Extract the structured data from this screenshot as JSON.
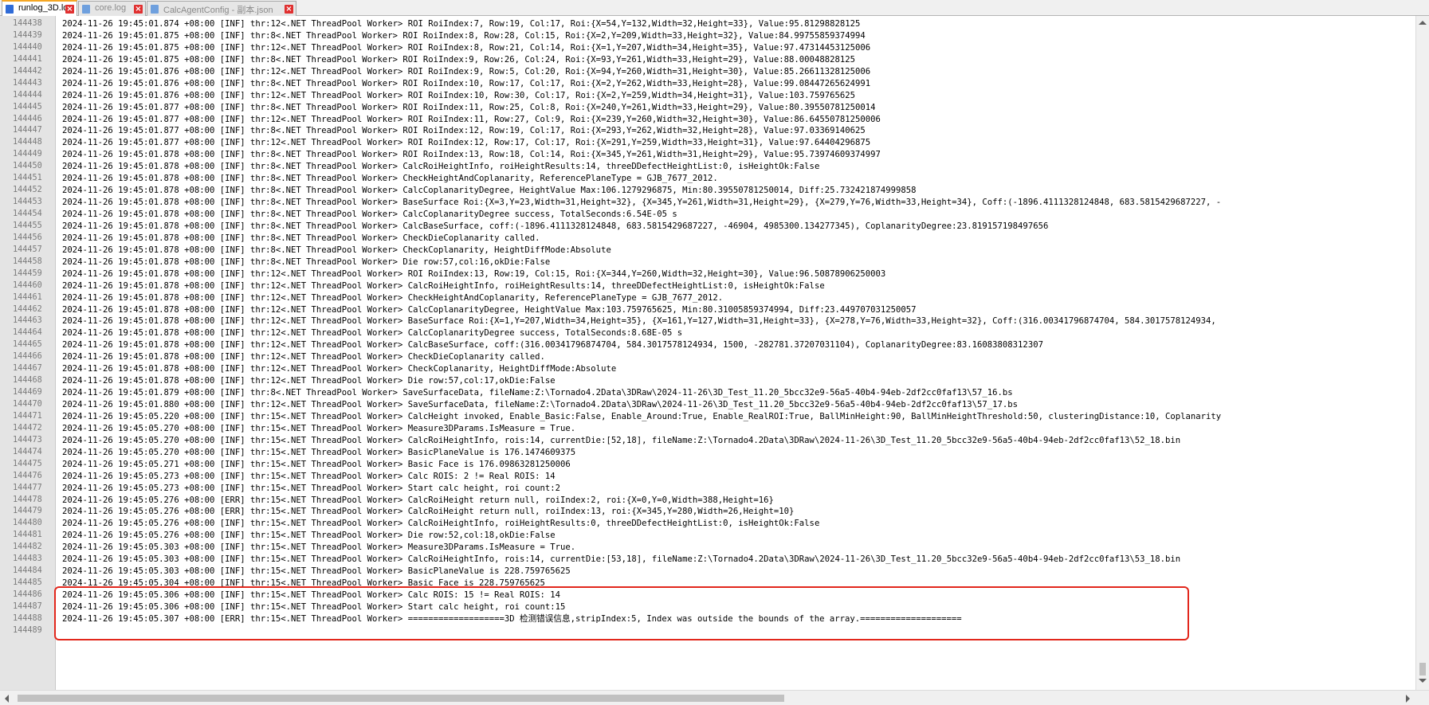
{
  "tabs": [
    {
      "label": "runlog_3D.log",
      "active": true
    },
    {
      "label": "core.log",
      "active": false
    },
    {
      "label": "CalcAgentConfig - 副本.json",
      "active": false
    }
  ],
  "log": {
    "lines": [
      {
        "num": "144438",
        "text": "2024-11-26 19:45:01.874 +08:00 [INF] thr:12<.NET ThreadPool Worker> ROI RoiIndex:7, Row:19, Col:17, Roi:{X=54,Y=132,Width=32,Height=33}, Value:95.81298828125"
      },
      {
        "num": "144439",
        "text": "2024-11-26 19:45:01.875 +08:00 [INF] thr:8<.NET ThreadPool Worker> ROI RoiIndex:8, Row:28, Col:15, Roi:{X=2,Y=209,Width=33,Height=32}, Value:84.99755859374994"
      },
      {
        "num": "144440",
        "text": "2024-11-26 19:45:01.875 +08:00 [INF] thr:12<.NET ThreadPool Worker> ROI RoiIndex:8, Row:21, Col:14, Roi:{X=1,Y=207,Width=34,Height=35}, Value:97.47314453125006"
      },
      {
        "num": "144441",
        "text": "2024-11-26 19:45:01.875 +08:00 [INF] thr:8<.NET ThreadPool Worker> ROI RoiIndex:9, Row:26, Col:24, Roi:{X=93,Y=261,Width=33,Height=29}, Value:88.00048828125"
      },
      {
        "num": "144442",
        "text": "2024-11-26 19:45:01.876 +08:00 [INF] thr:12<.NET ThreadPool Worker> ROI RoiIndex:9, Row:5, Col:20, Roi:{X=94,Y=260,Width=31,Height=30}, Value:85.26611328125006"
      },
      {
        "num": "144443",
        "text": "2024-11-26 19:45:01.876 +08:00 [INF] thr:8<.NET ThreadPool Worker> ROI RoiIndex:10, Row:17, Col:17, Roi:{X=2,Y=262,Width=33,Height=28}, Value:99.08447265624991"
      },
      {
        "num": "144444",
        "text": "2024-11-26 19:45:01.876 +08:00 [INF] thr:12<.NET ThreadPool Worker> ROI RoiIndex:10, Row:30, Col:17, Roi:{X=2,Y=259,Width=34,Height=31}, Value:103.759765625"
      },
      {
        "num": "144445",
        "text": "2024-11-26 19:45:01.877 +08:00 [INF] thr:8<.NET ThreadPool Worker> ROI RoiIndex:11, Row:25, Col:8, Roi:{X=240,Y=261,Width=33,Height=29}, Value:80.39550781250014"
      },
      {
        "num": "144446",
        "text": "2024-11-26 19:45:01.877 +08:00 [INF] thr:12<.NET ThreadPool Worker> ROI RoiIndex:11, Row:27, Col:9, Roi:{X=239,Y=260,Width=32,Height=30}, Value:86.64550781250006"
      },
      {
        "num": "144447",
        "text": "2024-11-26 19:45:01.877 +08:00 [INF] thr:8<.NET ThreadPool Worker> ROI RoiIndex:12, Row:19, Col:17, Roi:{X=293,Y=262,Width=32,Height=28}, Value:97.03369140625"
      },
      {
        "num": "144448",
        "text": "2024-11-26 19:45:01.877 +08:00 [INF] thr:12<.NET ThreadPool Worker> ROI RoiIndex:12, Row:17, Col:17, Roi:{X=291,Y=259,Width=33,Height=31}, Value:97.64404296875"
      },
      {
        "num": "144449",
        "text": "2024-11-26 19:45:01.878 +08:00 [INF] thr:8<.NET ThreadPool Worker> ROI RoiIndex:13, Row:18, Col:14, Roi:{X=345,Y=261,Width=31,Height=29}, Value:95.73974609374997"
      },
      {
        "num": "144450",
        "text": "2024-11-26 19:45:01.878 +08:00 [INF] thr:8<.NET ThreadPool Worker> CalcRoiHeightInfo, roiHeightResults:14, threeDDefectHeightList:0, isHeightOk:False"
      },
      {
        "num": "144451",
        "text": "2024-11-26 19:45:01.878 +08:00 [INF] thr:8<.NET ThreadPool Worker> CheckHeightAndCoplanarity, ReferencePlaneType = GJB_7677_2012."
      },
      {
        "num": "144452",
        "text": "2024-11-26 19:45:01.878 +08:00 [INF] thr:8<.NET ThreadPool Worker> CalcCoplanarityDegree, HeightValue Max:106.1279296875, Min:80.39550781250014, Diff:25.732421874999858"
      },
      {
        "num": "144453",
        "text": "2024-11-26 19:45:01.878 +08:00 [INF] thr:8<.NET ThreadPool Worker> BaseSurface Roi:{X=3,Y=23,Width=31,Height=32}, {X=345,Y=261,Width=31,Height=29}, {X=279,Y=76,Width=33,Height=34}, Coff:(-1896.4111328124848, 683.5815429687227, -"
      },
      {
        "num": "144454",
        "text": "2024-11-26 19:45:01.878 +08:00 [INF] thr:8<.NET ThreadPool Worker> CalcCoplanarityDegree success, TotalSeconds:6.54E-05 s"
      },
      {
        "num": "144455",
        "text": "2024-11-26 19:45:01.878 +08:00 [INF] thr:8<.NET ThreadPool Worker> CalcBaseSurface, coff:(-1896.4111328124848, 683.5815429687227, -46904, 4985300.134277345), CoplanarityDegree:23.819157198497656"
      },
      {
        "num": "144456",
        "text": "2024-11-26 19:45:01.878 +08:00 [INF] thr:8<.NET ThreadPool Worker> CheckDieCoplanarity called."
      },
      {
        "num": "144457",
        "text": "2024-11-26 19:45:01.878 +08:00 [INF] thr:8<.NET ThreadPool Worker> CheckCoplanarity, HeightDiffMode:Absolute"
      },
      {
        "num": "144458",
        "text": "2024-11-26 19:45:01.878 +08:00 [INF] thr:8<.NET ThreadPool Worker> Die row:57,col:16,okDie:False"
      },
      {
        "num": "144459",
        "text": "2024-11-26 19:45:01.878 +08:00 [INF] thr:12<.NET ThreadPool Worker> ROI RoiIndex:13, Row:19, Col:15, Roi:{X=344,Y=260,Width=32,Height=30}, Value:96.50878906250003"
      },
      {
        "num": "144460",
        "text": "2024-11-26 19:45:01.878 +08:00 [INF] thr:12<.NET ThreadPool Worker> CalcRoiHeightInfo, roiHeightResults:14, threeDDefectHeightList:0, isHeightOk:False"
      },
      {
        "num": "144461",
        "text": "2024-11-26 19:45:01.878 +08:00 [INF] thr:12<.NET ThreadPool Worker> CheckHeightAndCoplanarity, ReferencePlaneType = GJB_7677_2012."
      },
      {
        "num": "144462",
        "text": "2024-11-26 19:45:01.878 +08:00 [INF] thr:12<.NET ThreadPool Worker> CalcCoplanarityDegree, HeightValue Max:103.759765625, Min:80.31005859374994, Diff:23.449707031250057"
      },
      {
        "num": "144463",
        "text": "2024-11-26 19:45:01.878 +08:00 [INF] thr:12<.NET ThreadPool Worker> BaseSurface Roi:{X=1,Y=207,Width=34,Height=35}, {X=161,Y=127,Width=31,Height=33}, {X=278,Y=76,Width=33,Height=32}, Coff:(316.00341796874704, 584.3017578124934,"
      },
      {
        "num": "144464",
        "text": "2024-11-26 19:45:01.878 +08:00 [INF] thr:12<.NET ThreadPool Worker> CalcCoplanarityDegree success, TotalSeconds:8.68E-05 s"
      },
      {
        "num": "144465",
        "text": "2024-11-26 19:45:01.878 +08:00 [INF] thr:12<.NET ThreadPool Worker> CalcBaseSurface, coff:(316.00341796874704, 584.3017578124934, 1500, -282781.37207031104), CoplanarityDegree:83.16083808312307"
      },
      {
        "num": "144466",
        "text": "2024-11-26 19:45:01.878 +08:00 [INF] thr:12<.NET ThreadPool Worker> CheckDieCoplanarity called."
      },
      {
        "num": "144467",
        "text": "2024-11-26 19:45:01.878 +08:00 [INF] thr:12<.NET ThreadPool Worker> CheckCoplanarity, HeightDiffMode:Absolute"
      },
      {
        "num": "144468",
        "text": "2024-11-26 19:45:01.878 +08:00 [INF] thr:12<.NET ThreadPool Worker> Die row:57,col:17,okDie:False"
      },
      {
        "num": "144469",
        "text": "2024-11-26 19:45:01.879 +08:00 [INF] thr:8<.NET ThreadPool Worker> SaveSurfaceData, fileName:Z:\\Tornado4.2Data\\3DRaw\\2024-11-26\\3D_Test_11.20_5bcc32e9-56a5-40b4-94eb-2df2cc0faf13\\57_16.bs"
      },
      {
        "num": "144470",
        "text": "2024-11-26 19:45:01.880 +08:00 [INF] thr:12<.NET ThreadPool Worker> SaveSurfaceData, fileName:Z:\\Tornado4.2Data\\3DRaw\\2024-11-26\\3D_Test_11.20_5bcc32e9-56a5-40b4-94eb-2df2cc0faf13\\57_17.bs"
      },
      {
        "num": "144471",
        "text": "2024-11-26 19:45:05.220 +08:00 [INF] thr:15<.NET ThreadPool Worker> CalcHeight invoked, Enable_Basic:False, Enable_Around:True, Enable_RealROI:True, BallMinHeight:90, BallMinHeightThreshold:50, clusteringDistance:10, Coplanarity"
      },
      {
        "num": "144472",
        "text": "2024-11-26 19:45:05.270 +08:00 [INF] thr:15<.NET ThreadPool Worker> Measure3DParams.IsMeasure = True."
      },
      {
        "num": "144473",
        "text": "2024-11-26 19:45:05.270 +08:00 [INF] thr:15<.NET ThreadPool Worker> CalcRoiHeightInfo, rois:14, currentDie:[52,18], fileName:Z:\\Tornado4.2Data\\3DRaw\\2024-11-26\\3D_Test_11.20_5bcc32e9-56a5-40b4-94eb-2df2cc0faf13\\52_18.bin"
      },
      {
        "num": "144474",
        "text": "2024-11-26 19:45:05.270 +08:00 [INF] thr:15<.NET ThreadPool Worker> BasicPlaneValue is 176.1474609375"
      },
      {
        "num": "144475",
        "text": "2024-11-26 19:45:05.271 +08:00 [INF] thr:15<.NET ThreadPool Worker> Basic Face is 176.09863281250006"
      },
      {
        "num": "144476",
        "text": "2024-11-26 19:45:05.273 +08:00 [INF] thr:15<.NET ThreadPool Worker> Calc ROIS: 2 != Real ROIS: 14"
      },
      {
        "num": "144477",
        "text": "2024-11-26 19:45:05.273 +08:00 [INF] thr:15<.NET ThreadPool Worker> Start calc height, roi count:2"
      },
      {
        "num": "144478",
        "text": "2024-11-26 19:45:05.276 +08:00 [ERR] thr:15<.NET ThreadPool Worker> CalcRoiHeight return null, roiIndex:2, roi:{X=0,Y=0,Width=388,Height=16}"
      },
      {
        "num": "144479",
        "text": "2024-11-26 19:45:05.276 +08:00 [ERR] thr:15<.NET ThreadPool Worker> CalcRoiHeight return null, roiIndex:13, roi:{X=345,Y=280,Width=26,Height=10}"
      },
      {
        "num": "144480",
        "text": "2024-11-26 19:45:05.276 +08:00 [INF] thr:15<.NET ThreadPool Worker> CalcRoiHeightInfo, roiHeightResults:0, threeDDefectHeightList:0, isHeightOk:False"
      },
      {
        "num": "144481",
        "text": "2024-11-26 19:45:05.276 +08:00 [INF] thr:15<.NET ThreadPool Worker> Die row:52,col:18,okDie:False"
      },
      {
        "num": "144482",
        "text": "2024-11-26 19:45:05.303 +08:00 [INF] thr:15<.NET ThreadPool Worker> Measure3DParams.IsMeasure = True."
      },
      {
        "num": "144483",
        "text": "2024-11-26 19:45:05.303 +08:00 [INF] thr:15<.NET ThreadPool Worker> CalcRoiHeightInfo, rois:14, currentDie:[53,18], fileName:Z:\\Tornado4.2Data\\3DRaw\\2024-11-26\\3D_Test_11.20_5bcc32e9-56a5-40b4-94eb-2df2cc0faf13\\53_18.bin"
      },
      {
        "num": "144484",
        "text": "2024-11-26 19:45:05.303 +08:00 [INF] thr:15<.NET ThreadPool Worker> BasicPlaneValue is 228.759765625"
      },
      {
        "num": "144485",
        "text": "2024-11-26 19:45:05.304 +08:00 [INF] thr:15<.NET ThreadPool Worker> Basic Face is 228.759765625"
      },
      {
        "num": "144486",
        "text": "2024-11-26 19:45:05.306 +08:00 [INF] thr:15<.NET ThreadPool Worker> Calc ROIS: 15 != Real ROIS: 14"
      },
      {
        "num": "144487",
        "text": "2024-11-26 19:45:05.306 +08:00 [INF] thr:15<.NET ThreadPool Worker> Start calc height, roi count:15"
      },
      {
        "num": "144488",
        "text": "2024-11-26 19:45:05.307 +08:00 [ERR] thr:15<.NET ThreadPool Worker> ===================3D 检测错误信息,stripIndex:5, Index was outside the bounds of the array.===================="
      },
      {
        "num": "144489",
        "text": ""
      }
    ]
  },
  "colors": {
    "highlight_border": "#e2271c",
    "active_tab_accent": "#f5a623",
    "gutter_bg": "#e4e4e4"
  }
}
